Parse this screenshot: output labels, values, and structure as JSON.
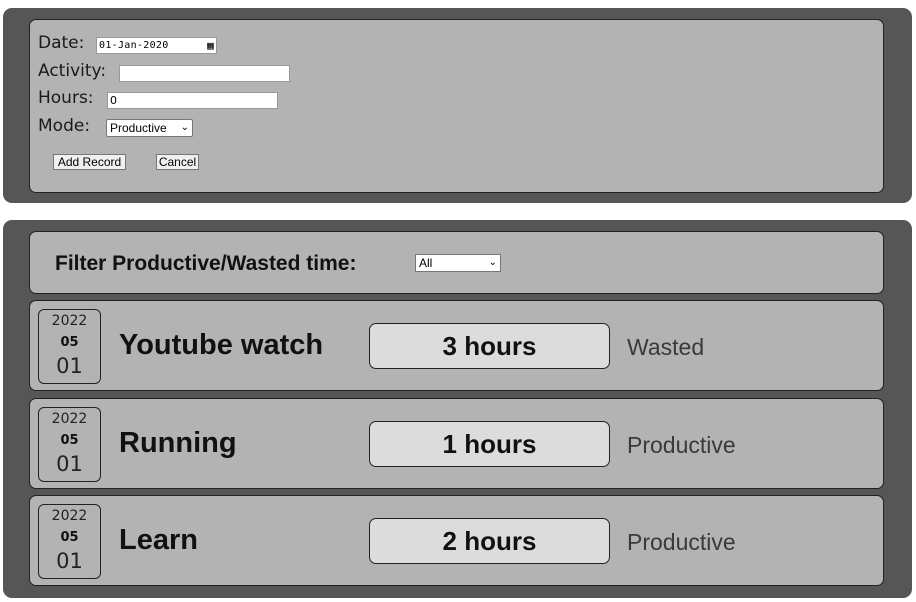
{
  "form": {
    "date_label": "Date:",
    "date_value": "01-Jan-2020",
    "activity_label": "Activity:",
    "activity_value": "",
    "hours_label": "Hours:",
    "hours_value": "0",
    "mode_label": "Mode:",
    "mode_value": "Productive",
    "add_button": "Add Record",
    "cancel_button": "Cancel"
  },
  "filter": {
    "label": "Filter Productive/Wasted time:",
    "value": "All"
  },
  "records": [
    {
      "year": "2022",
      "month": "05",
      "day": "01",
      "title": "Youtube watch",
      "hours": "3 hours",
      "mode": "Wasted"
    },
    {
      "year": "2022",
      "month": "05",
      "day": "01",
      "title": "Running",
      "hours": "1 hours",
      "mode": "Productive"
    },
    {
      "year": "2022",
      "month": "05",
      "day": "01",
      "title": "Learn",
      "hours": "2 hours",
      "mode": "Productive"
    }
  ],
  "icons": {
    "calendar": "calendar-icon",
    "dropdown": "chevron-down-icon"
  }
}
